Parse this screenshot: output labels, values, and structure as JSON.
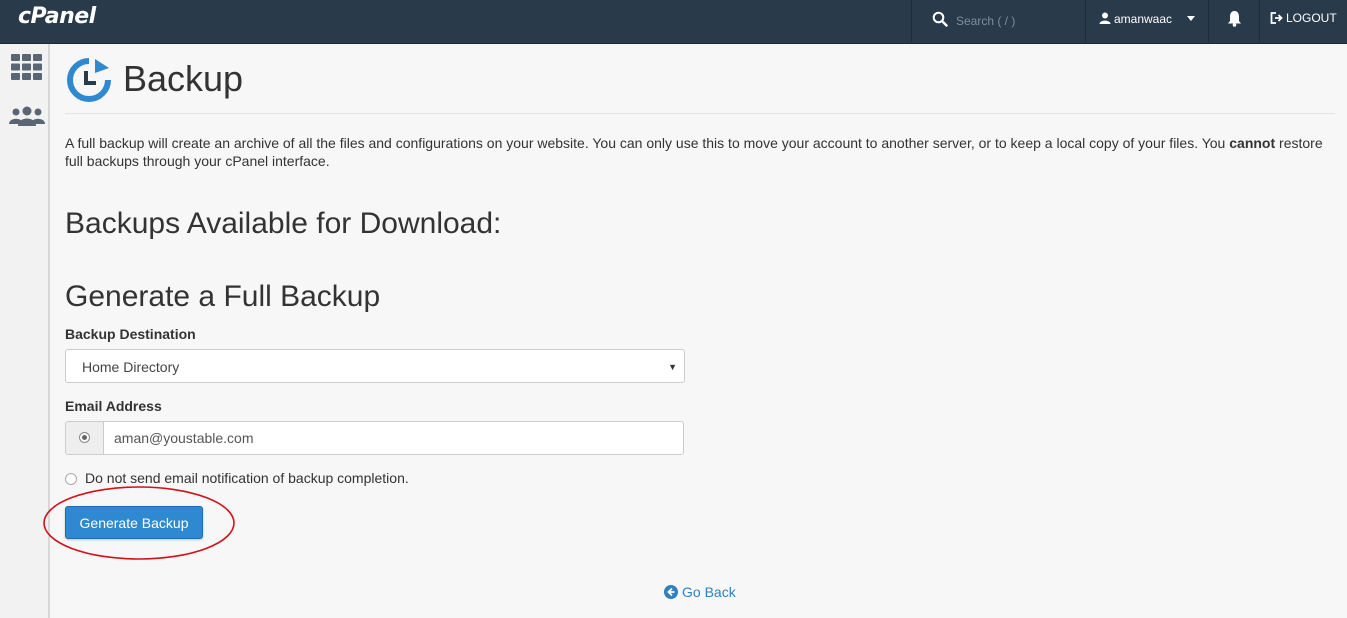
{
  "header": {
    "logo": "cPanel",
    "search_placeholder": "Search ( / )",
    "username": "amanwaac",
    "logout_label": "LOGOUT"
  },
  "page": {
    "title": "Backup",
    "description_part1": "A full backup will create an archive of all the files and configurations on your website. You can only use this to move your account to another server, or to keep a local copy of your files. You ",
    "description_bold": "cannot",
    "description_part2": " restore full backups through your cPanel interface."
  },
  "sections": {
    "available_heading": "Backups Available for Download:",
    "generate_heading": "Generate a Full Backup"
  },
  "form": {
    "destination_label": "Backup Destination",
    "destination_value": "Home Directory",
    "email_label": "Email Address",
    "email_value": "aman@youstable.com",
    "no_notify_label": "Do not send email notification of backup completion.",
    "generate_button": "Generate Backup"
  },
  "footer": {
    "go_back": "Go Back"
  },
  "colors": {
    "topbar": "#293a4a",
    "primary_button": "#2f89d0",
    "link": "#2f7fc1",
    "annotation": "#d0121b"
  }
}
